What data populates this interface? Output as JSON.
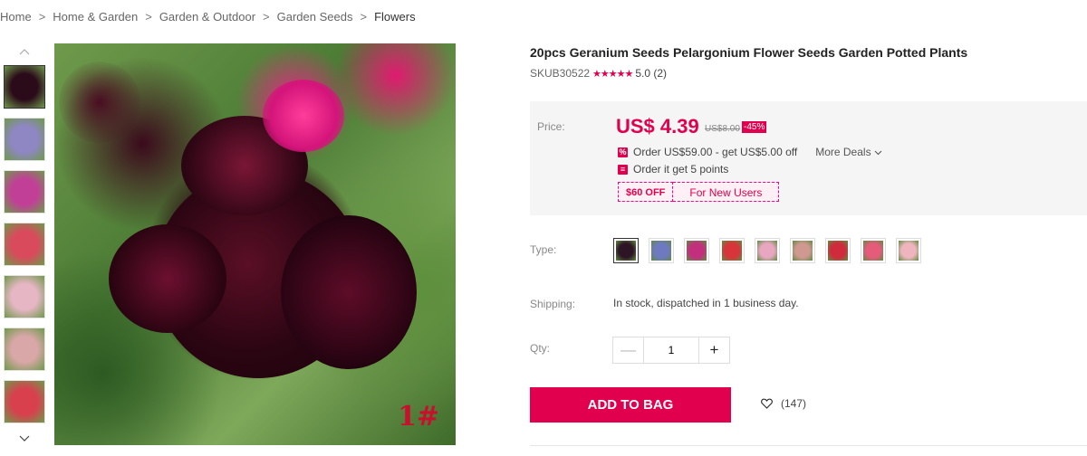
{
  "breadcrumb": {
    "items": [
      "Home",
      "Home & Garden",
      "Garden & Outdoor",
      "Garden Seeds"
    ],
    "current": "Flowers",
    "separator": ">"
  },
  "gallery": {
    "up_icon": "chevron-up-icon",
    "down_icon": "chevron-down-icon",
    "thumb_colors": [
      "#2b0a1a",
      "#8f86c4",
      "#c23f97",
      "#d94a5c",
      "#e6b6c4",
      "#d9a7a7",
      "#d8404e"
    ],
    "main_tag": "1#"
  },
  "product": {
    "title": "20pcs Geranium Seeds Pelargonium Flower Seeds Garden Potted Plants",
    "sku": "SKUB30522",
    "stars": "★★★★★",
    "rating": "5.0 (2)"
  },
  "price": {
    "label": "Price:",
    "currency": "US$",
    "amount": "4.39",
    "old": "US$8.00",
    "discount": "-45%",
    "deal1": "Order US$59.00 - get US$5.00 off",
    "more_deals": "More Deals",
    "deal2": "Order it get 5 points",
    "coupon_amount": "$60 OFF",
    "coupon_text": "For New Users"
  },
  "type": {
    "label": "Type:",
    "swatches": [
      "#2e1526",
      "#6f79c0",
      "#c2307d",
      "#d8343c",
      "#e7a7c0",
      "#cf9890",
      "#cf2b3c",
      "#e45c7a",
      "#efb5be"
    ]
  },
  "shipping": {
    "label": "Shipping:",
    "value": "In stock, dispatched in 1 business day."
  },
  "qty": {
    "label": "Qty:",
    "value": "1",
    "minus": "—",
    "plus": "+"
  },
  "actions": {
    "add_to_bag": "ADD TO BAG",
    "wishlist_count": "(147)"
  },
  "colors": {
    "accent": "#e0004d"
  }
}
